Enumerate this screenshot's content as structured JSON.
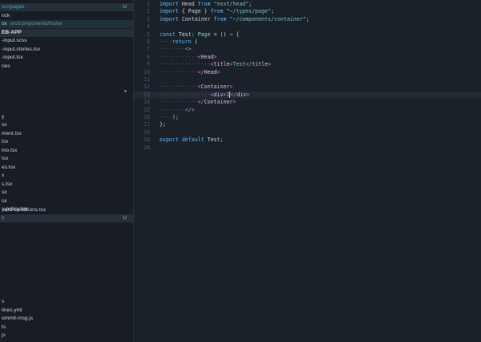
{
  "sidebar": {
    "rows": [
      {
        "label": "src/pages",
        "prefix": "r",
        "status": "U",
        "style": "hl teal"
      },
      {
        "label": "ock",
        "style": ""
      },
      {
        "label": "sx",
        "extra": "src/components/footer",
        "style": "hl2"
      },
      {
        "label": "EB-APP",
        "style": "hdr hl"
      },
      {
        "label": "-input.scss",
        "style": ""
      },
      {
        "label": "-input.stories.tsx",
        "style": ""
      },
      {
        "label": "-input.tsx",
        "style": ""
      },
      {
        "label": "ries",
        "style": ""
      },
      {
        "label": "",
        "style": ""
      },
      {
        "label": "",
        "style": ""
      },
      {
        "label": "",
        "style": "",
        "dot": true
      },
      {
        "label": "",
        "style": ""
      },
      {
        "label": "",
        "style": ""
      },
      {
        "label": "y",
        "style": ""
      },
      {
        "label": "sx",
        "style": ""
      },
      {
        "label": "ment.tsx",
        "style": ""
      },
      {
        "label": "tsx",
        "style": ""
      },
      {
        "label": "mo.tsx",
        "style": ""
      },
      {
        "label": "tsx",
        "style": ""
      },
      {
        "label": "es.tsx",
        "style": ""
      },
      {
        "label": "x",
        "style": ""
      },
      {
        "label": "s.tsx",
        "style": ""
      },
      {
        "label": "sx",
        "style": ""
      },
      {
        "label": "sx",
        "style": ""
      },
      {
        "label": "y-policy.tsx",
        "style": ""
      },
      {
        "label": "s.tsx",
        "style": ""
      },
      {
        "label": "-and-conditions.tsx",
        "style": ""
      },
      {
        "label": "x",
        "status": "U",
        "style": "hl teal"
      }
    ],
    "bottom_rows": [
      {
        "label": "s"
      },
      {
        "label": "lines.yml"
      },
      {
        "label": "ommit-msg.js"
      },
      {
        "label": "ts"
      },
      {
        "label": "js"
      }
    ]
  },
  "editor": {
    "lines": [
      {
        "n": "1",
        "html": "<span class='kw'>import</span> <span class='plain'>Head</span> <span class='kw'>from</span> <span class='str'>\"next/head\"</span><span class='plain'>;</span>"
      },
      {
        "n": "2",
        "html": "<span class='kw'>import</span> <span class='plain'>{ Page }</span> <span class='kw'>from</span> <span class='str'>\"~/types/page\"</span><span class='plain'>;</span>"
      },
      {
        "n": "3",
        "html": "<span class='kw'>import</span> <span class='plain'>Container</span> <span class='kw'>from</span> <span class='str'>\"~/components/container\"</span><span class='plain'>;</span>"
      },
      {
        "n": "4",
        "html": ""
      },
      {
        "n": "5",
        "html": "<span class='kw'>const</span> <span class='ident'>Test</span><span class='plain'>:</span> <span class='type'>Page</span> <span class='plain'>= () ⇒ {</span>"
      },
      {
        "n": "6",
        "html": "<span class='dim'>····</span><span class='kw'>return</span> <span class='plain'>(</span>"
      },
      {
        "n": "7",
        "html": "<span class='dim'>········</span><span class='tag'>&lt;&gt;</span>"
      },
      {
        "n": "8",
        "html": "<span class='dim'>············</span><span class='tag'>&lt;</span><span class='tagname'>Head</span><span class='tag'>&gt;</span>"
      },
      {
        "n": "9",
        "html": "<span class='dim'>················</span><span class='tag'>&lt;</span><span class='tagname'>title</span><span class='tag'>&gt;</span><span class='str'>Test</span><span class='tag'>&lt;/</span><span class='tagname'>title</span><span class='tag'>&gt;</span>"
      },
      {
        "n": "10",
        "html": "<span class='dim'>············</span><span class='tag'>&lt;/</span><span class='tagname'>Head</span><span class='tag'>&gt;</span>"
      },
      {
        "n": "11",
        "html": ""
      },
      {
        "n": "12",
        "html": "<span class='dim'>············</span><span class='tag'>&lt;</span><span class='tagname'>Container</span><span class='tag'>&gt;</span>"
      },
      {
        "n": "13",
        "html": "<span class='dim'>················</span><span class='tag'>&lt;</span><span class='tagname'>div</span><span class='tag'>&gt;</span><span class='str'>1</span><span class='cursor'></span><span class='tag'>&lt;/</span><span class='tagname'>div</span><span class='tag'>&gt;</span>",
        "current": true
      },
      {
        "n": "14",
        "html": "<span class='dim'>············</span><span class='tag'>&lt;/</span><span class='tagname'>Container</span><span class='tag'>&gt;</span>"
      },
      {
        "n": "15",
        "html": "<span class='dim'>········</span><span class='tag'>&lt;/&gt;</span>"
      },
      {
        "n": "16",
        "html": "<span class='dim'>····</span><span class='plain'>);</span>"
      },
      {
        "n": "17",
        "html": "<span class='plain'>};</span>"
      },
      {
        "n": "18",
        "html": ""
      },
      {
        "n": "19",
        "html": "<span class='kw'>export</span> <span class='kw'>default</span> <span class='plain'>Test;</span>"
      },
      {
        "n": "20",
        "html": ""
      }
    ]
  }
}
